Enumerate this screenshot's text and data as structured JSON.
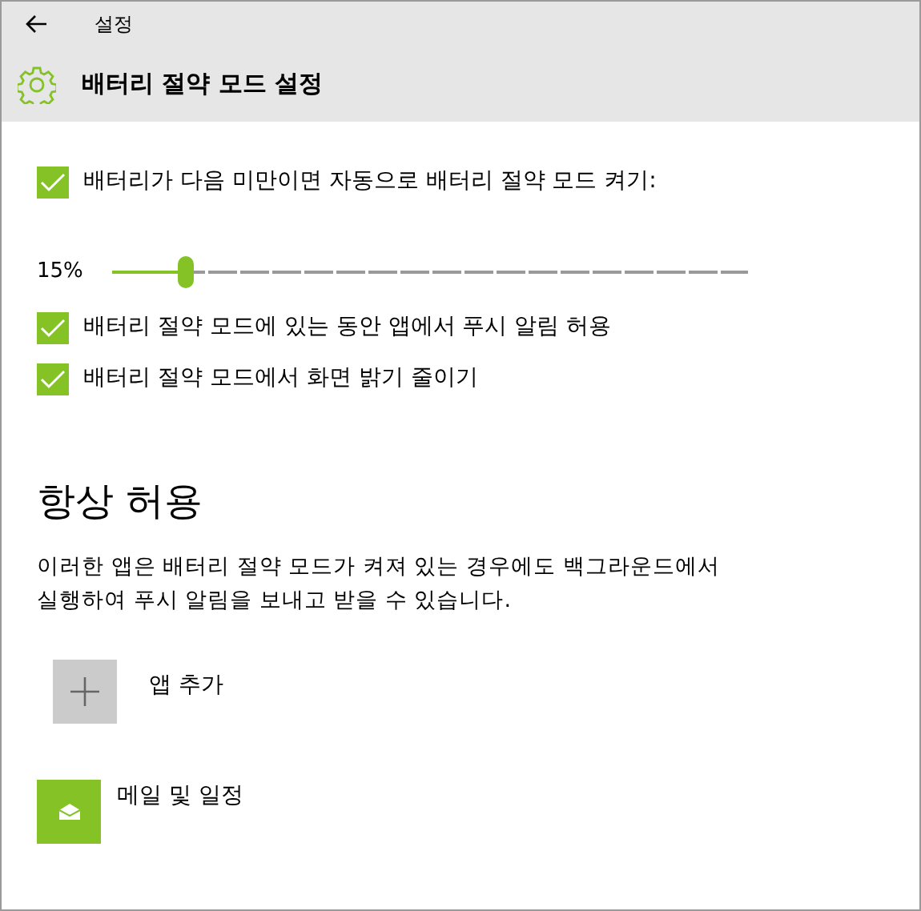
{
  "window": {
    "title": "설정"
  },
  "header": {
    "title": "배터리 절약 모드 설정"
  },
  "auto_saver": {
    "label": "배터리가 다음 미만이면 자동으로 배터리 절약 모드 켜기:",
    "checked": true
  },
  "threshold": {
    "reading": "15%",
    "level": 0.115
  },
  "options": [
    {
      "label": "배터리 절약 모드에 있는 동안 앱에서 푸시 알림 허용",
      "checked": true
    },
    {
      "label": "배터리 절약 모드에서 화면 밝기 줄이기",
      "checked": true
    }
  ],
  "always_allowed": {
    "heading": "항상 허용",
    "description": "이러한 앱은 배터리 절약 모드가 켜져 있는 경우에도 백그라운드에서 실행하여 푸시 알림을 보내고 받을 수 있습니다.",
    "apps": [
      {
        "kind": "add",
        "label": "앱 추가"
      },
      {
        "kind": "mail",
        "label": "메일 및 일정"
      }
    ]
  }
}
